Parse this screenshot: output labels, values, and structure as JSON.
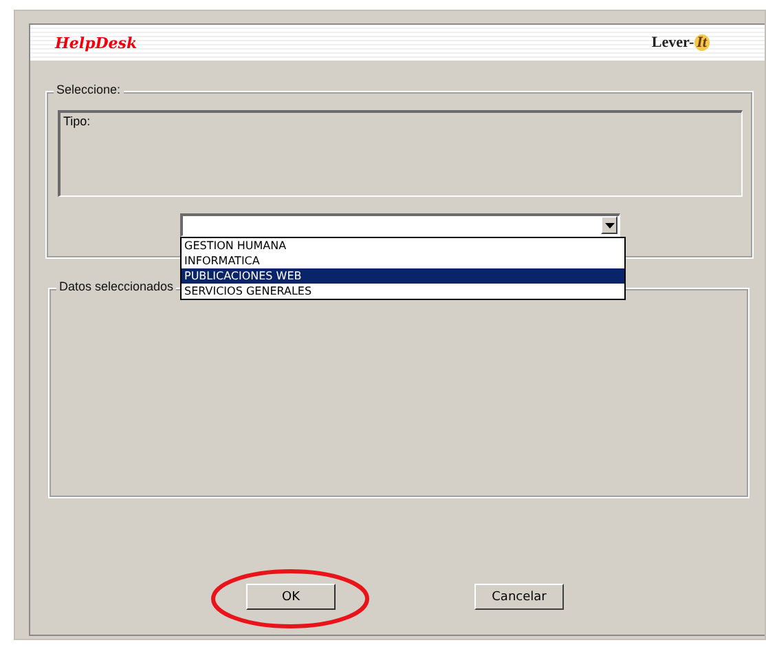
{
  "header": {
    "title": "HelpDesk",
    "logo": {
      "text": "Lever-",
      "accent": "It"
    }
  },
  "selection_group": {
    "legend": "Seleccione:",
    "type_box": {
      "label": "Tipo:"
    }
  },
  "combo": {
    "expanded": true,
    "options": [
      {
        "label": "GESTION HUMANA",
        "selected": false
      },
      {
        "label": "INFORMATICA",
        "selected": false
      },
      {
        "label": "PUBLICACIONES WEB",
        "selected": true
      },
      {
        "label": "SERVICIOS GENERALES",
        "selected": false
      }
    ]
  },
  "data_group": {
    "legend": "Datos seleccionados"
  },
  "buttons": [
    {
      "label": "OK",
      "highlighted": true
    },
    {
      "label": "Cancelar",
      "highlighted": false
    }
  ]
}
